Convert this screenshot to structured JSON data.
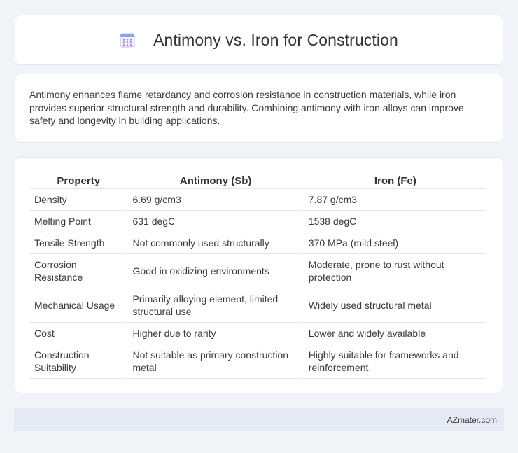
{
  "header": {
    "icon": "calendar-icon",
    "title": "Antimony vs. Iron for Construction"
  },
  "intro": {
    "text": "Antimony enhances flame retardancy and corrosion resistance in construction materials, while iron provides superior structural strength and durability. Combining antimony with iron alloys can improve safety and longevity in building applications."
  },
  "table": {
    "headers": [
      "Property",
      "Antimony (Sb)",
      "Iron (Fe)"
    ],
    "rows": [
      [
        "Density",
        "6.69 g/cm3",
        "7.87 g/cm3"
      ],
      [
        "Melting Point",
        "631 degC",
        "1538 degC"
      ],
      [
        "Tensile Strength",
        "Not commonly used structurally",
        "370 MPa (mild steel)"
      ],
      [
        "Corrosion Resistance",
        "Good in oxidizing environments",
        "Moderate, prone to rust without protection"
      ],
      [
        "Mechanical Usage",
        "Primarily alloying element, limited structural use",
        "Widely used structural metal"
      ],
      [
        "Cost",
        "Higher due to rarity",
        "Lower and widely available"
      ],
      [
        "Construction Suitability",
        "Not suitable as primary construction metal",
        "Highly suitable for frameworks and reinforcement"
      ]
    ]
  },
  "footer": {
    "text": "AZmater.com"
  },
  "colors": {
    "background": "#f0f3f8",
    "footer_bg": "#e5ebf4",
    "icon_accent": "#7b6fd6"
  }
}
